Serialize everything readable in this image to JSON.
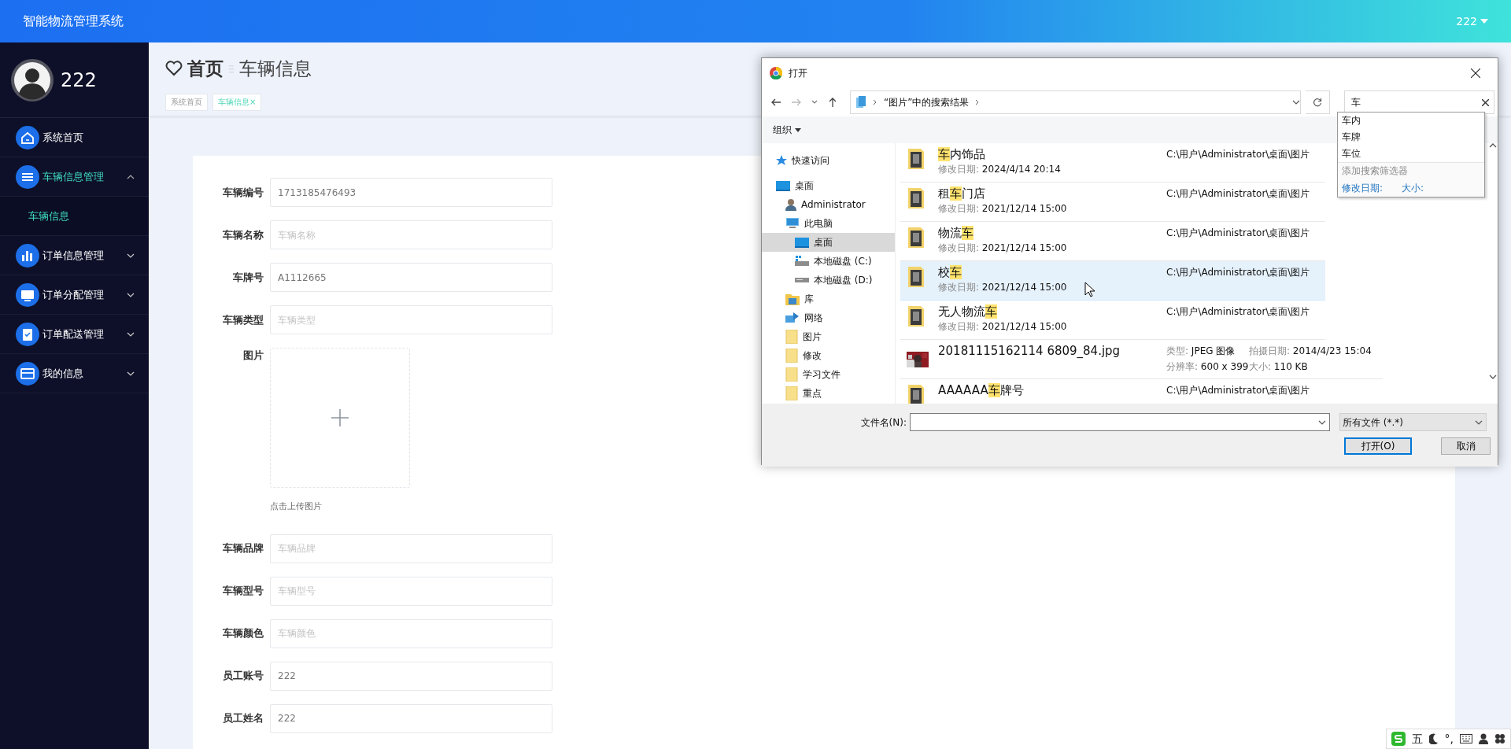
{
  "app": {
    "title": "智能物流管理系统",
    "user": "222"
  },
  "sidebar": {
    "user_name": "222",
    "items": [
      {
        "label": "系统首页",
        "selected": false
      },
      {
        "label": "车辆信息管理",
        "selected": false,
        "expanded": true,
        "children": [
          {
            "label": "车辆信息",
            "selected": true
          }
        ]
      },
      {
        "label": "订单信息管理",
        "selected": false,
        "expanded": false
      },
      {
        "label": "订单分配管理",
        "selected": false,
        "expanded": false
      },
      {
        "label": "订单配送管理",
        "selected": false,
        "expanded": false
      },
      {
        "label": "我的信息",
        "selected": false,
        "expanded": false
      }
    ]
  },
  "breadcrumb": {
    "home": "首页",
    "current": "车辆信息"
  },
  "tabs": [
    {
      "label": "系统首页",
      "selected": false
    },
    {
      "label": "车辆信息",
      "selected": true,
      "close": "×"
    }
  ],
  "form": {
    "fields": [
      {
        "label": "车辆编号",
        "kind": "input",
        "value": "1713185476493"
      },
      {
        "label": "车辆名称",
        "kind": "input",
        "placeholder": "车辆名称"
      },
      {
        "label": "车牌号",
        "kind": "input",
        "value": "A1112665"
      },
      {
        "label": "车辆类型",
        "kind": "input",
        "placeholder": "车辆类型"
      },
      {
        "label": "图片",
        "kind": "upload",
        "hint": "点击上传图片"
      },
      {
        "label": "车辆品牌",
        "kind": "input",
        "placeholder": "车辆品牌"
      },
      {
        "label": "车辆型号",
        "kind": "input",
        "placeholder": "车辆型号"
      },
      {
        "label": "车辆颜色",
        "kind": "input",
        "placeholder": "车辆颜色"
      },
      {
        "label": "员工账号",
        "kind": "input",
        "value": "222"
      },
      {
        "label": "员工姓名",
        "kind": "input",
        "value": "222"
      }
    ]
  },
  "file_dialog": {
    "title": "打开",
    "address": "“图片”中的搜索结果",
    "search": {
      "value": "车",
      "suggestions": [
        "车内",
        "车牌",
        "车位"
      ],
      "filter_hint": "添加搜索筛选器",
      "filters": [
        "修改日期:",
        "大小:"
      ]
    },
    "organize": "组织",
    "nav": [
      {
        "label": "快速访问",
        "kind": "star",
        "selected": false
      },
      {
        "label": "桌面",
        "kind": "desktop",
        "selected": false,
        "children": [
          {
            "label": "Administrator",
            "kind": "user",
            "selected": false
          },
          {
            "label": "此电脑",
            "kind": "computer",
            "selected": false,
            "children": [
              {
                "label": "桌面",
                "kind": "desktop",
                "selected": true
              },
              {
                "label": "本地磁盘 (C:)",
                "kind": "systemdrive",
                "selected": false
              },
              {
                "label": "本地磁盘 (D:)",
                "kind": "drive",
                "selected": false
              }
            ]
          },
          {
            "label": "库",
            "kind": "library",
            "selected": false
          },
          {
            "label": "网络",
            "kind": "network",
            "selected": false
          },
          {
            "label": "图片",
            "kind": "folder",
            "selected": false
          },
          {
            "label": "修改",
            "kind": "folder",
            "selected": false
          },
          {
            "label": "学习文件",
            "kind": "folder",
            "selected": false
          },
          {
            "label": "重点",
            "kind": "folder",
            "selected": false
          }
        ]
      }
    ],
    "files": [
      {
        "kind": "folder",
        "selected": false,
        "name": [
          {
            "text": "车",
            "match": true
          },
          {
            "text": "内饰品",
            "match": false
          }
        ],
        "date_label": "修改日期:",
        "date": "2024/4/14 20:14",
        "location": "C:\\用户\\Administrator\\桌面\\图片"
      },
      {
        "kind": "folder",
        "selected": false,
        "name": [
          {
            "text": "租",
            "match": false
          },
          {
            "text": "车",
            "match": true
          },
          {
            "text": "门店",
            "match": false
          }
        ],
        "date_label": "修改日期:",
        "date": "2021/12/14 15:00",
        "location": "C:\\用户\\Administrator\\桌面\\图片"
      },
      {
        "kind": "folder",
        "selected": false,
        "name": [
          {
            "text": "物流",
            "match": false
          },
          {
            "text": "车",
            "match": true
          }
        ],
        "date_label": "修改日期:",
        "date": "2021/12/14 15:00",
        "location": "C:\\用户\\Administrator\\桌面\\图片"
      },
      {
        "kind": "folder",
        "selected": true,
        "name": [
          {
            "text": "校",
            "match": false
          },
          {
            "text": "车",
            "match": true
          }
        ],
        "date_label": "修改日期:",
        "date": "2021/12/14 15:00",
        "location": "C:\\用户\\Administrator\\桌面\\图片"
      },
      {
        "kind": "folder",
        "selected": false,
        "name": [
          {
            "text": "无人物流",
            "match": false
          },
          {
            "text": "车",
            "match": true
          }
        ],
        "date_label": "修改日期:",
        "date": "2021/12/14 15:00",
        "location": "C:\\用户\\Administrator\\桌面\\图片"
      },
      {
        "selected": false,
        "name": [
          {
            "text": "20181115162114 6809_84.jpg",
            "match": false
          }
        ],
        "details": [
          {
            "label": "类型:",
            "value": "JPEG 图像"
          },
          {
            "label": "拍摄日期:",
            "value": "2014/4/23 15:04"
          },
          {
            "label": "分辨率:",
            "value": "600 x 399"
          },
          {
            "label": "大小:",
            "value": "110 KB"
          }
        ]
      },
      {
        "kind": "folder",
        "selected": false,
        "name": [
          {
            "text": "AAAAAA",
            "match": false
          },
          {
            "text": "车",
            "match": true
          },
          {
            "text": "牌号",
            "match": false
          }
        ],
        "location": "C:\\用户\\Administrator\\桌面\\图片"
      }
    ],
    "file_name": {
      "label": "文件名(N):"
    },
    "file_type": "所有文件 (*.*)",
    "buttons": [
      {
        "label": "打开(O)",
        "default": true
      },
      {
        "label": "取消",
        "default": false
      }
    ]
  },
  "ime_toolbar": {
    "mode": "五",
    "punctuation": "°,"
  }
}
